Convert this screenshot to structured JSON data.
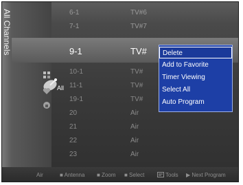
{
  "sidebar": {
    "title": "All Channels"
  },
  "selected": {
    "number": "9-1",
    "name": "TV#",
    "mode_label": "All"
  },
  "rows": [
    {
      "number": "6-1",
      "name": "TV#6"
    },
    {
      "number": "7-1",
      "name": "TV#7"
    },
    {
      "number": "10-1",
      "name": "TV#"
    },
    {
      "number": "11-1",
      "name": "TV#"
    },
    {
      "number": "19-1",
      "name": "TV#"
    },
    {
      "number": "20",
      "name": "Air"
    },
    {
      "number": "21",
      "name": "Air"
    },
    {
      "number": "22",
      "name": "Air"
    },
    {
      "number": "23",
      "name": "Air"
    }
  ],
  "context_menu": {
    "items": [
      {
        "label": "Delete"
      },
      {
        "label": "Add to Favorite"
      },
      {
        "label": "Timer Viewing"
      },
      {
        "label": "Select All"
      },
      {
        "label": "Auto Program"
      }
    ]
  },
  "footer": {
    "source": "Air",
    "antenna": "■ Antenna",
    "zoom": "■ Zoom",
    "select": "■ Select",
    "tools": "Tools",
    "next": "▶ Next Program"
  },
  "icons": [
    "antenna-icon",
    "grid-icon",
    "heart-icon",
    "lock-icon"
  ],
  "colors": {
    "menu_bg": "#1d3fa6",
    "menu_border": "#9fb1e6",
    "highlight": "#6a6a6a"
  }
}
